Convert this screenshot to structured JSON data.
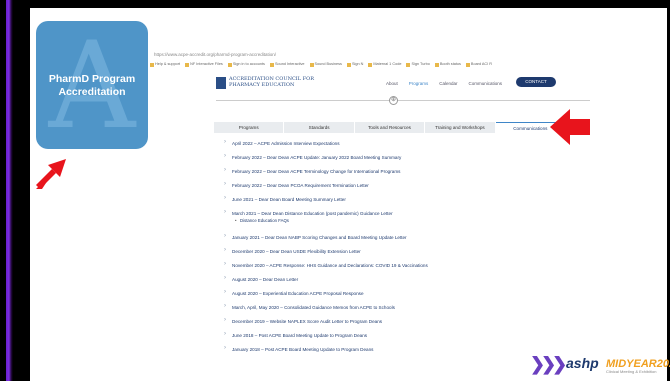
{
  "card": {
    "letter": "A",
    "title": "PharmD Program Accreditation"
  },
  "browser": {
    "url": "https://www.acpe-accredit.org/pharmd-program-accreditation/",
    "bookmarks": [
      "Help & support",
      "NF Interactive Files",
      "Sign in to accounts",
      "Sound Interactive",
      "Sound Business",
      "Sign N",
      "Maternal 1 Code",
      "Sign Turbo",
      "Booth status",
      "Board ACI R"
    ]
  },
  "site": {
    "logo_line1": "ACCREDITATION COUNCIL FOR",
    "logo_line2": "PHARMACY EDUCATION",
    "nav": [
      "About",
      "Programs",
      "Calendar",
      "Communications"
    ],
    "contact_label": "CONTACT",
    "divider_symbol": "⊕"
  },
  "tabs": [
    {
      "label": "Programs",
      "active": false
    },
    {
      "label": "Standards",
      "active": false
    },
    {
      "label": "Tools and Resources",
      "active": false
    },
    {
      "label": "Training and Workshops",
      "active": false
    },
    {
      "label": "Communications",
      "active": true
    }
  ],
  "items": [
    "April 2022 – ACPE Admission Interview Expectations",
    "February 2022 – Dear Dean ACPE Update: January 2022 Board Meeting Summary",
    "February 2022 – Dear Dean ACPE Terminology Change for International Programs",
    "February 2022 – Dear Dean PCOA Requirement Termination Letter",
    "June 2021 – Dear Dean Board Meeting Summary Letter",
    "March 2021 – Dear Dean Distance Education (post pandemic) Guidance Letter",
    "January 2021 – Dear Dean NABP Scoring Changes and Board Meeting Update Letter",
    "December 2020 – Dear Dean USDE Flexibility Extension Letter",
    "November 2020 – ACPE Response: HHS Guidance and Declarations: COVID 19 & Vaccinations",
    "August 2020 – Dear Dean Letter",
    "August 2020 – Experiential Education ACPE Proposal Response",
    "March, April, May 2020 – Consolidated Guidance Memos from ACPE to Schools",
    "December 2019 – Website NAPLEX Score Audit Letter to Program Deans",
    "June 2018 – Post ACPE Board Meeting Update to Program Deans",
    "January 2018 – Post ACPE Board Meeting Update to Program Deans"
  ],
  "subitem": "Distance Education FAQs",
  "branding": {
    "chevrons": "❯❯❯",
    "ashp": "ashp",
    "midyear": "MIDYEAR2022",
    "tagline": "Clinical Meeting & Exhibition"
  },
  "colors": {
    "arrow": "#e8141c",
    "card": "#4f95c8",
    "stripe": "#7b2fe0",
    "navy": "#1e3a6e"
  }
}
